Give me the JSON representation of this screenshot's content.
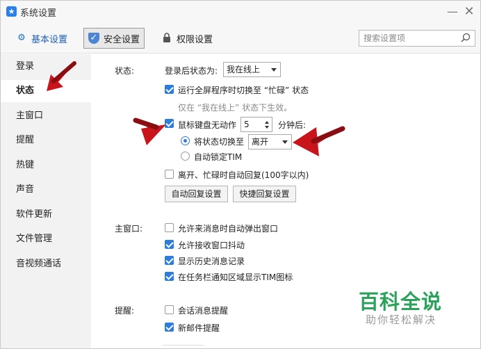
{
  "window": {
    "title": "系统设置",
    "minimize_glyph": "—",
    "close_glyph": "✕"
  },
  "tabs": [
    {
      "label": "基本设置",
      "icon": "gear-icon",
      "active": false
    },
    {
      "label": "安全设置",
      "icon": "shield-icon",
      "active": true
    },
    {
      "label": "权限设置",
      "icon": "lock-icon",
      "active": false
    }
  ],
  "search": {
    "placeholder": "搜索设置项",
    "icon": "search-icon"
  },
  "sidebar": {
    "items": [
      {
        "label": "登录",
        "active": false
      },
      {
        "label": "状态",
        "active": true
      },
      {
        "label": "主窗口",
        "active": false
      },
      {
        "label": "提醒",
        "active": false
      },
      {
        "label": "热键",
        "active": false
      },
      {
        "label": "声音",
        "active": false
      },
      {
        "label": "软件更新",
        "active": false
      },
      {
        "label": "文件管理",
        "active": false
      },
      {
        "label": "音视频通话",
        "active": false
      }
    ]
  },
  "status_section": {
    "label": "状态:",
    "after_login_label": "登录后状态为:",
    "after_login_value": "我在线上",
    "fullscreen_busy": {
      "label": "运行全屏程序时切换至 “忙碌” 状态",
      "checked": true
    },
    "fullscreen_hint": "仅在 “我在线上” 状态下生效。",
    "idle": {
      "label": "鼠标键盘无动作",
      "checked": true,
      "minutes": "5",
      "suffix": "分钟后:"
    },
    "switch_option": {
      "label": "将状态切换至",
      "selected": true,
      "value": "离开"
    },
    "lock_option": {
      "label": "自动锁定TIM",
      "selected": false
    },
    "auto_reply": {
      "label": "离开、忙碌时自动回复(100字以内)",
      "checked": false
    },
    "auto_reply_button": "自动回复设置",
    "quick_reply_button": "快捷回复设置"
  },
  "main_window_section": {
    "label": "主窗口:",
    "options": [
      {
        "label": "允许来消息时自动弹出窗口",
        "checked": false
      },
      {
        "label": "允许接收窗口抖动",
        "checked": true
      },
      {
        "label": "显示历史消息记录",
        "checked": true
      },
      {
        "label": "在任务栏通知区域显示TIM图标",
        "checked": true
      }
    ]
  },
  "reminder_section": {
    "label": "提醒:",
    "options": [
      {
        "label": "会话消息提醒",
        "checked": false
      },
      {
        "label": "新邮件提醒",
        "checked": true
      }
    ]
  },
  "watermark": {
    "main": "百科全说",
    "sub": "助你轻松解决"
  },
  "colors": {
    "accent": "#2d7ddc",
    "annotation_arrow": "#c8141b",
    "watermark_green": "#2aa25a"
  }
}
